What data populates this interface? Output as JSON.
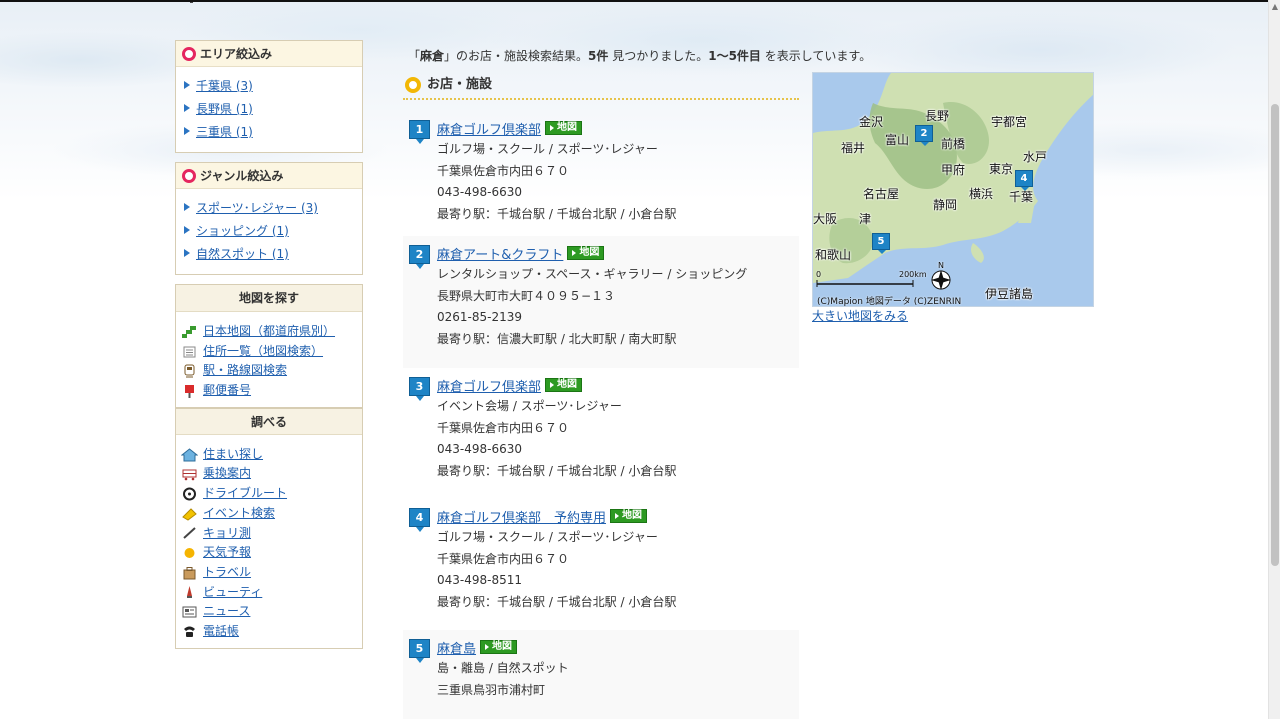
{
  "area_filter": {
    "title": "エリア絞込み",
    "items": [
      {
        "label": "千葉県 (3)"
      },
      {
        "label": "長野県 (1)"
      },
      {
        "label": "三重県 (1)"
      }
    ]
  },
  "genre_filter": {
    "title": "ジャンル絞込み",
    "items": [
      {
        "label": "スポーツ･レジャー (3)"
      },
      {
        "label": "ショッピング (1)"
      },
      {
        "label": "自然スポット (1)"
      }
    ]
  },
  "map_search": {
    "title": "地図を探す",
    "items": [
      {
        "label": "日本地図（都道府県別）",
        "icon": "japan-map-icon"
      },
      {
        "label": "住所一覧（地図検索）",
        "icon": "address-list-icon"
      },
      {
        "label": "駅・路線図検索",
        "icon": "train-icon"
      },
      {
        "label": "郵便番号",
        "icon": "postbox-icon"
      }
    ]
  },
  "research": {
    "title": "調べる",
    "items": [
      {
        "label": "住まい探し",
        "icon": "house-icon"
      },
      {
        "label": "乗換案内",
        "icon": "transfer-train-icon"
      },
      {
        "label": "ドライブルート",
        "icon": "steering-wheel-icon"
      },
      {
        "label": "イベント検索",
        "icon": "event-ticket-icon"
      },
      {
        "label": "キョリ測",
        "icon": "ruler-icon"
      },
      {
        "label": "天気予報",
        "icon": "sun-icon"
      },
      {
        "label": "トラベル",
        "icon": "luggage-icon"
      },
      {
        "label": "ビューティ",
        "icon": "beauty-icon"
      },
      {
        "label": "ニュース",
        "icon": "newspaper-icon"
      },
      {
        "label": "電話帳",
        "icon": "phone-icon"
      }
    ]
  },
  "results": {
    "prefix": "「",
    "keyword": "麻倉",
    "middle": "」のお店・施設検索結果。",
    "count": "5件",
    "found": " 見つかりました。",
    "range": "1～5件目",
    "suffix": " を表示しています。"
  },
  "section_title": "お店・施設",
  "map_button_label": "地図",
  "listings": [
    {
      "num": "1",
      "name": "麻倉ゴルフ倶楽部",
      "category": "ゴルフ場・スクール / スポーツ･レジャー",
      "address": "千葉県佐倉市内田６７０",
      "phone": "043-498-6630",
      "station": "最寄り駅：千城台駅 / 千城台北駅 / 小倉台駅"
    },
    {
      "num": "2",
      "name": "麻倉アート&クラフト",
      "category": "レンタルショップ・スペース・ギャラリー / ショッピング",
      "address": "長野県大町市大町４０９５−１３",
      "phone": "0261-85-2139",
      "station": "最寄り駅：信濃大町駅 / 北大町駅 / 南大町駅"
    },
    {
      "num": "3",
      "name": "麻倉ゴルフ倶楽部",
      "category": "イベント会場 / スポーツ･レジャー",
      "address": "千葉県佐倉市内田６７０",
      "phone": "043-498-6630",
      "station": "最寄り駅：千城台駅 / 千城台北駅 / 小倉台駅"
    },
    {
      "num": "4",
      "name": "麻倉ゴルフ倶楽部　予約専用",
      "category": "ゴルフ場・スクール / スポーツ･レジャー",
      "address": "千葉県佐倉市内田６７０",
      "phone": "043-498-8511",
      "station": "最寄り駅：千城台駅 / 千城台北駅 / 小倉台駅"
    },
    {
      "num": "5",
      "name": "麻倉島",
      "category": "島・離島 / 自然スポット",
      "address": "三重県鳥羽市浦村町"
    }
  ],
  "map": {
    "cities": [
      "金沢",
      "長野",
      "宇都宮",
      "富山",
      "前橋",
      "福井",
      "水戸",
      "東京",
      "甲府",
      "名古屋",
      "横浜",
      "千葉",
      "静岡",
      "大阪",
      "津",
      "和歌山",
      "伊豆諸島"
    ],
    "pins": [
      "2",
      "4",
      "5"
    ],
    "scale_zero": "0",
    "scale_max": "200km",
    "compass": "N",
    "credit": "(C)Mapion 地図データ (C)ZENRIN",
    "big_map_link": "大きい地図をみる",
    "colors": {
      "sea": "#a9c9ec",
      "land": "#cfe0b2",
      "mountain": "#9fbf86"
    }
  }
}
